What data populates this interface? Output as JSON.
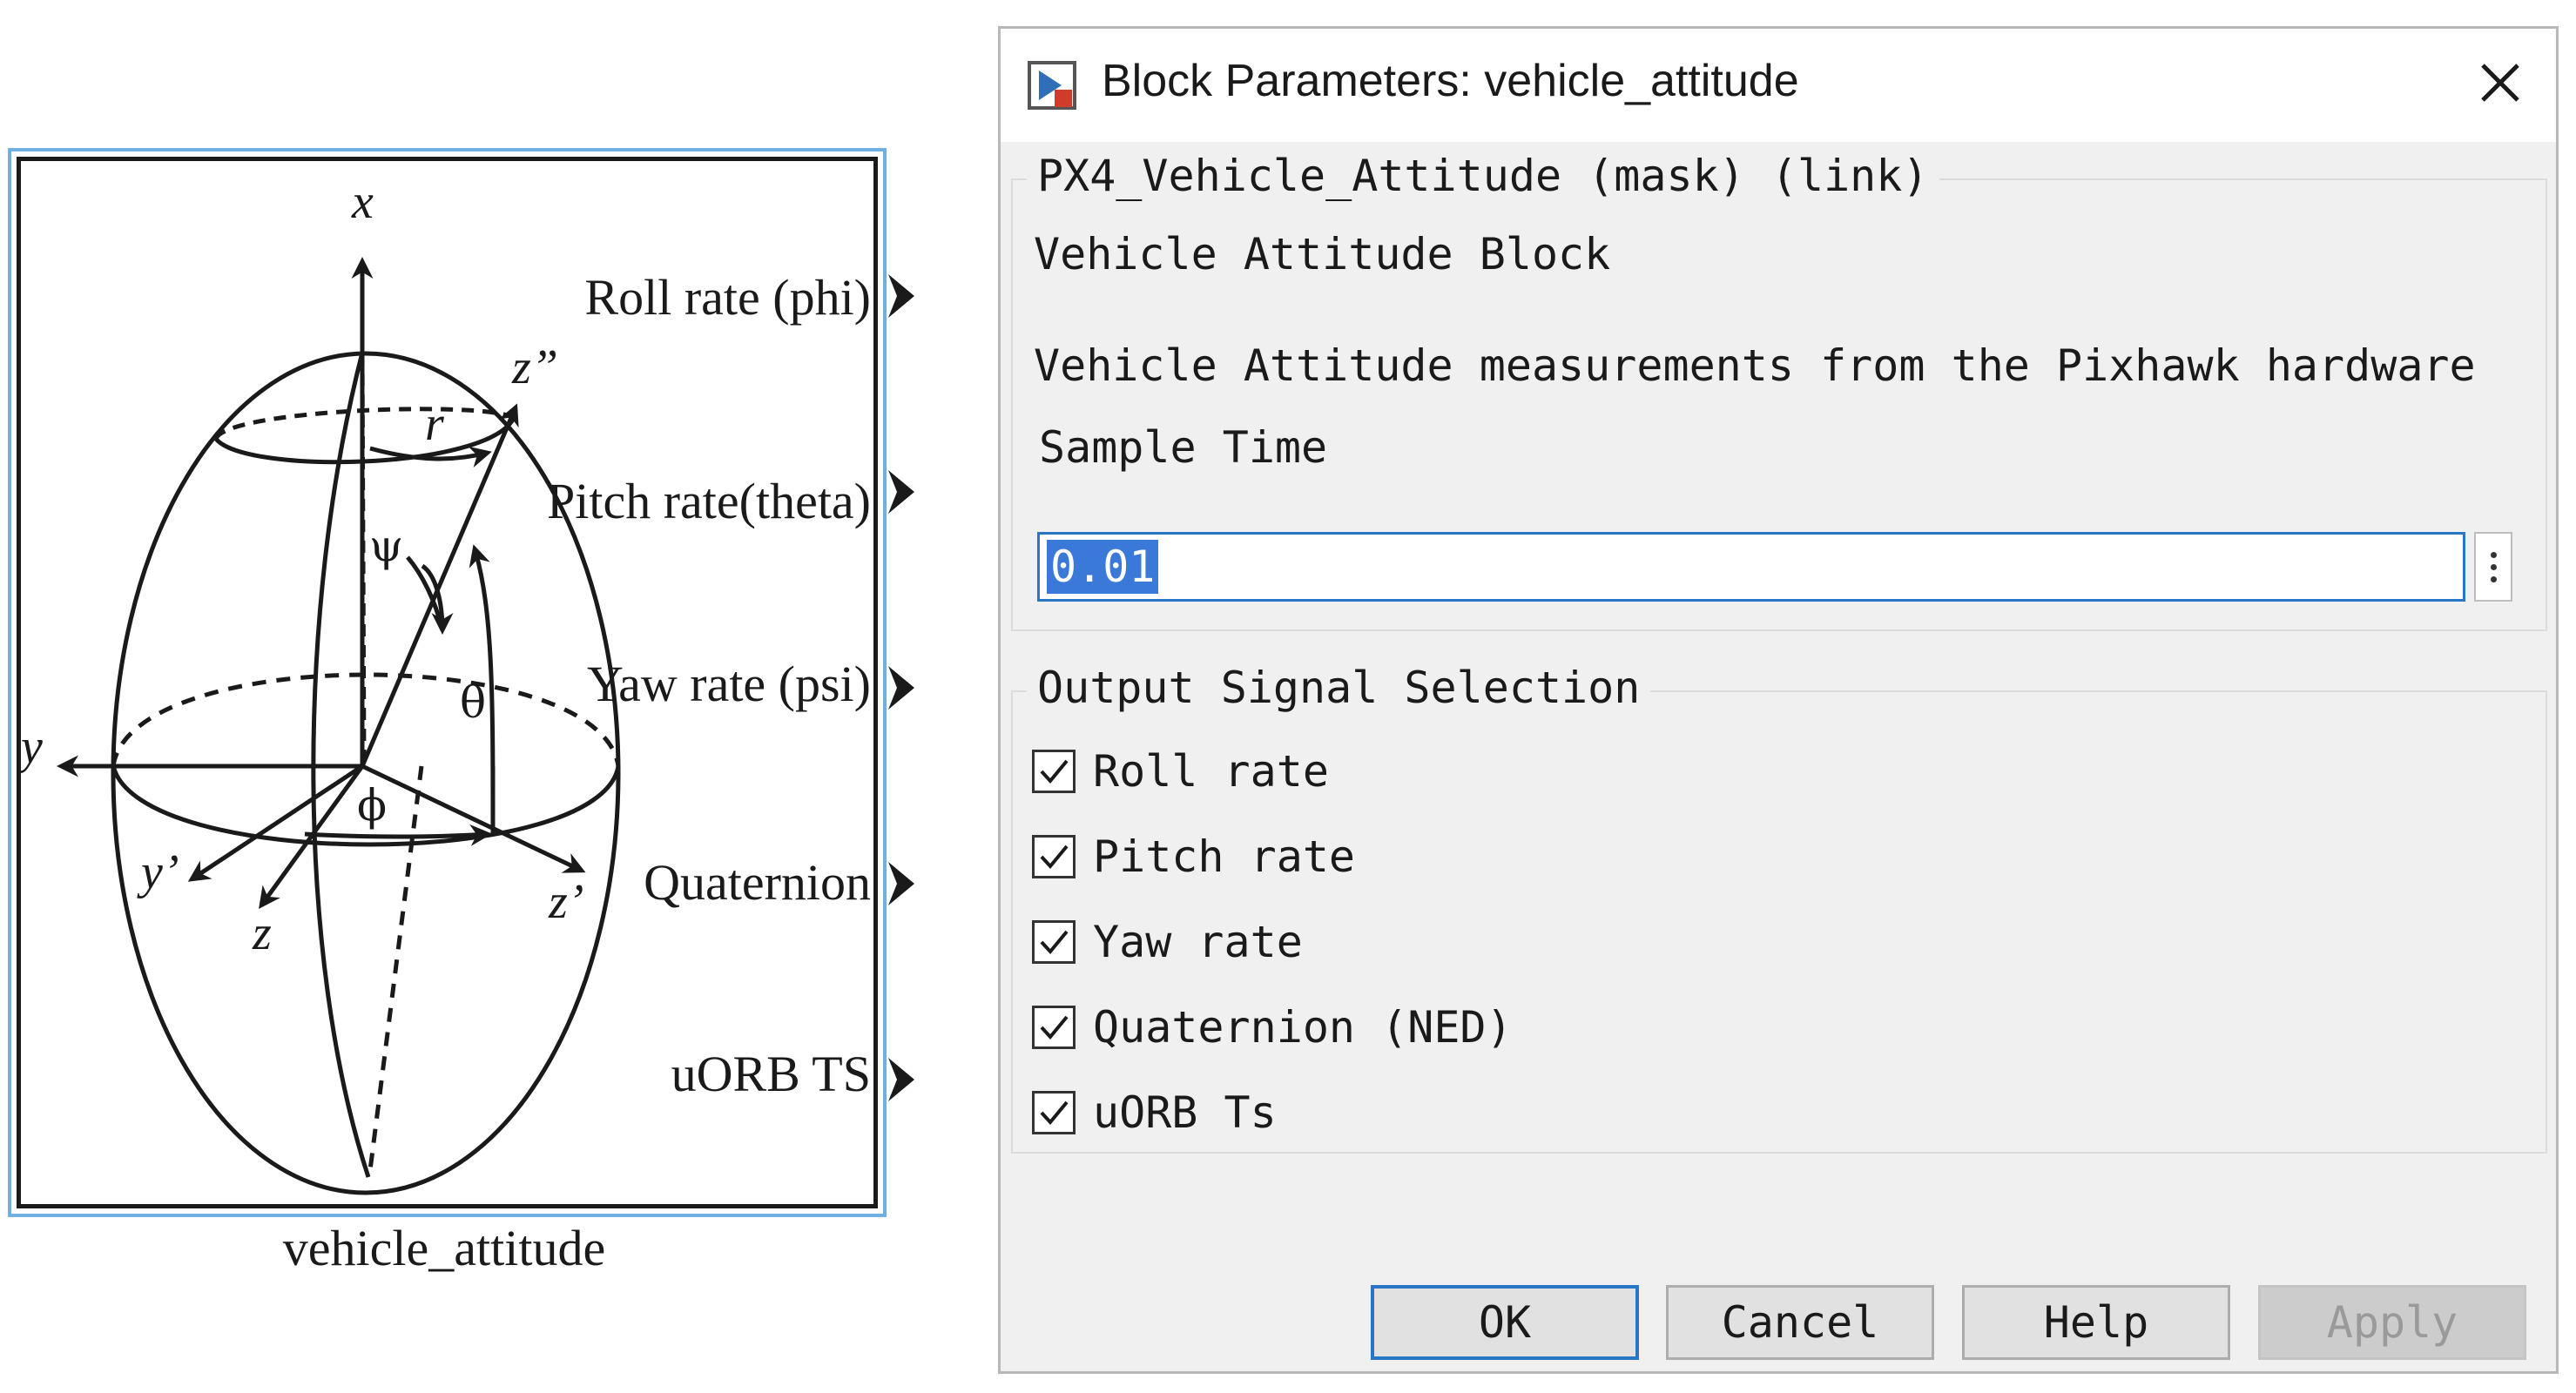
{
  "block": {
    "name": "vehicle_attitude",
    "ports": [
      "Roll rate (phi)",
      "Pitch rate(theta)",
      "Yaw rate (psi)",
      "Quaternion",
      "uORB TS"
    ],
    "axis_labels": {
      "x": "x",
      "y": "y",
      "z": "z",
      "y_prime": "y’",
      "z_prime": "z’",
      "z_double_prime": "z”",
      "r": "r"
    },
    "angle_labels": {
      "psi": "ψ",
      "theta": "θ",
      "phi": "ϕ"
    },
    "icon": "attitude-ellipsoid-diagram"
  },
  "dialog": {
    "title": "Block Parameters: vehicle_attitude",
    "title_icon": "simulink-block-icon",
    "close_icon": "close-icon",
    "mask_group_label": "PX4_Vehicle_Attitude (mask) (link)",
    "block_type": "Vehicle Attitude  Block",
    "description": "Vehicle Attitude measurements from the Pixhawk hardware",
    "sample_time_label": "Sample Time",
    "sample_time_value": "0.01",
    "output_group_label": "Output Signal Selection",
    "outputs": [
      {
        "label": "Roll rate",
        "checked": true
      },
      {
        "label": "Pitch rate",
        "checked": true
      },
      {
        "label": "Yaw rate",
        "checked": true
      },
      {
        "label": "Quaternion (NED)",
        "checked": true
      },
      {
        "label": "uORB Ts",
        "checked": true
      }
    ],
    "buttons": {
      "ok": "OK",
      "cancel": "Cancel",
      "help": "Help",
      "apply": "Apply"
    },
    "apply_enabled": false,
    "colors": {
      "focus_blue": "#2a76c6",
      "selection_blue": "#3b79d8",
      "body_gray": "#f0f0f0",
      "block_border": "#6fb0e0"
    }
  }
}
